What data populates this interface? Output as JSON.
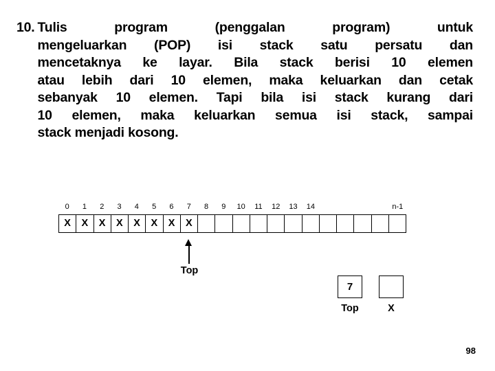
{
  "slide": {
    "question": {
      "number": "10.",
      "lines": [
        "Tulis program (penggalan program) untuk",
        "mengeluarkan (POP) isi stack satu persatu dan",
        "mencetaknya ke layar. Bila stack berisi 10 elemen",
        "atau lebih dari 10 elemen, maka keluarkan dan cetak",
        "sebanyak 10 elemen. Tapi bila isi stack kurang dari",
        "10 elemen, maka keluarkan semua isi stack, sampai",
        "stack menjadi kosong."
      ]
    },
    "diagram": {
      "index_labels": [
        "0",
        "1",
        "2",
        "3",
        "4",
        "5",
        "6",
        "7",
        "8",
        "9",
        "10",
        "11",
        "12",
        "13",
        "14"
      ],
      "last_index_label": "n-1",
      "cell_count": 20,
      "cells": [
        "X",
        "X",
        "X",
        "X",
        "X",
        "X",
        "X",
        "X",
        "",
        "",
        "",
        "",
        "",
        "",
        "",
        "",
        "",
        "",
        "",
        ""
      ],
      "filled_count": 8,
      "top_pointer_index": 7,
      "top_pointer_label": "Top",
      "variables": [
        {
          "value": "7",
          "label": "Top"
        },
        {
          "value": "",
          "label": "X"
        }
      ]
    },
    "page_number": "98"
  }
}
